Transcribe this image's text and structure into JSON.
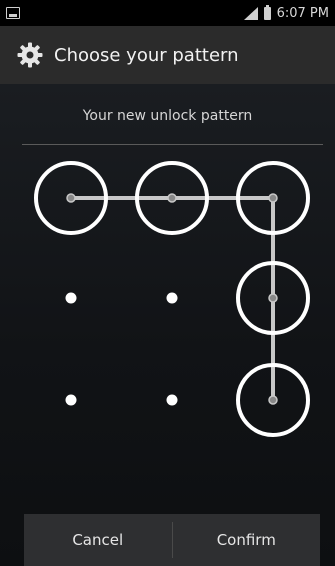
{
  "status_bar": {
    "time": "6:07 PM",
    "icons": [
      "notification-icon",
      "signal-icon",
      "battery-icon"
    ]
  },
  "action_bar": {
    "icon": "gear-icon",
    "title": "Choose your pattern"
  },
  "main": {
    "header": "Your new unlock pattern"
  },
  "pattern": {
    "grid_size": 3,
    "selected_sequence": [
      1,
      2,
      3,
      6,
      9
    ],
    "colors": {
      "ring": "#ffffff",
      "line": "#c8c8c8",
      "dot": "#ffffff"
    }
  },
  "buttons": {
    "cancel_label": "Cancel",
    "confirm_label": "Confirm"
  },
  "colors": {
    "status_bar_bg": "#000000",
    "action_bar_bg": "#2b2b2b",
    "button_bar_bg": "#2e2f31"
  }
}
